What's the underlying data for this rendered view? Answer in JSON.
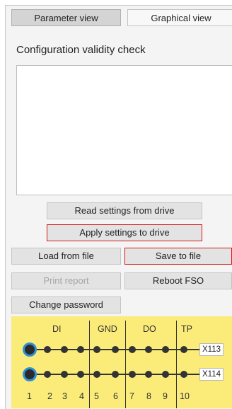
{
  "tabs": {
    "parameter_view": "Parameter view",
    "graphical_view": "Graphical view"
  },
  "config_check": {
    "title": "Configuration validity check"
  },
  "buttons": {
    "read_settings": "Read settings from drive",
    "apply_settings": "Apply settings to drive",
    "load_from_file": "Load from file",
    "save_to_file": "Save to file",
    "print_report": "Print report",
    "reboot_fso": "Reboot FSO",
    "change_password": "Change password"
  },
  "terminal": {
    "groups": [
      "DI",
      "GND",
      "DO",
      "TP"
    ],
    "connectors": [
      "X113",
      "X114"
    ],
    "pins": [
      "1",
      "2",
      "3",
      "4",
      "5",
      "6",
      "7",
      "8",
      "9",
      "10"
    ]
  },
  "colors": {
    "panel_bg": "#fbec7a",
    "highlight_border": "#d11a1a",
    "selected_ring": "#2f8fd8"
  }
}
